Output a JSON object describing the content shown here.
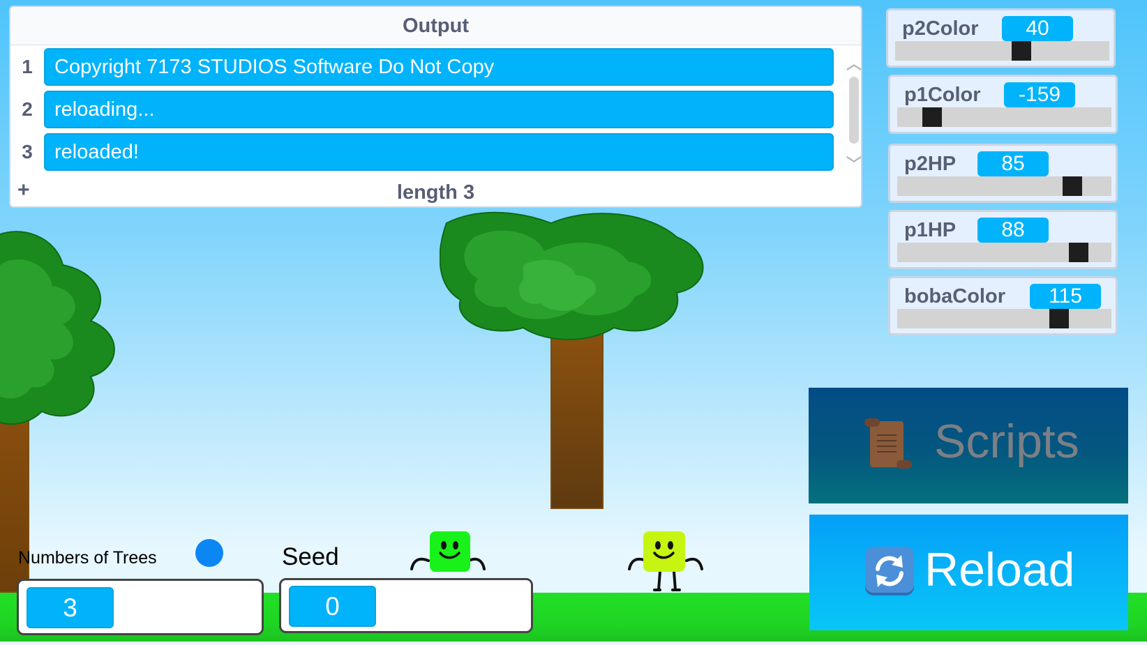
{
  "output_list": {
    "title": "Output",
    "items": [
      {
        "index": "1",
        "value": "Copyright 7173 STUDIOS Software Do Not Copy"
      },
      {
        "index": "2",
        "value": "reloading..."
      },
      {
        "index": "3",
        "value": "reloaded!"
      }
    ],
    "add_label": "+",
    "length_label": "length 3"
  },
  "sliders": [
    {
      "name": "p2Color",
      "value": "40",
      "level": 0.6
    },
    {
      "name": "p1Color",
      "value": "-159",
      "level": 0.13
    },
    {
      "name": "p2HP",
      "value": "85",
      "level": 0.85
    },
    {
      "name": "p1HP",
      "value": "88",
      "level": 0.88
    },
    {
      "name": "bobaColor",
      "value": "115",
      "level": 0.78
    }
  ],
  "buttons": {
    "scripts_label": "Scripts",
    "reload_label": "Reload"
  },
  "inputs": {
    "trees_label": "Numbers of Trees",
    "trees_value": "3",
    "seed_label": "Seed",
    "seed_value": "0"
  },
  "colors": {
    "sky": "#4fc4fb",
    "grass": "#22e026",
    "player1": "#19f21a",
    "player2": "#c6f511",
    "accent": "#00b3fb"
  }
}
